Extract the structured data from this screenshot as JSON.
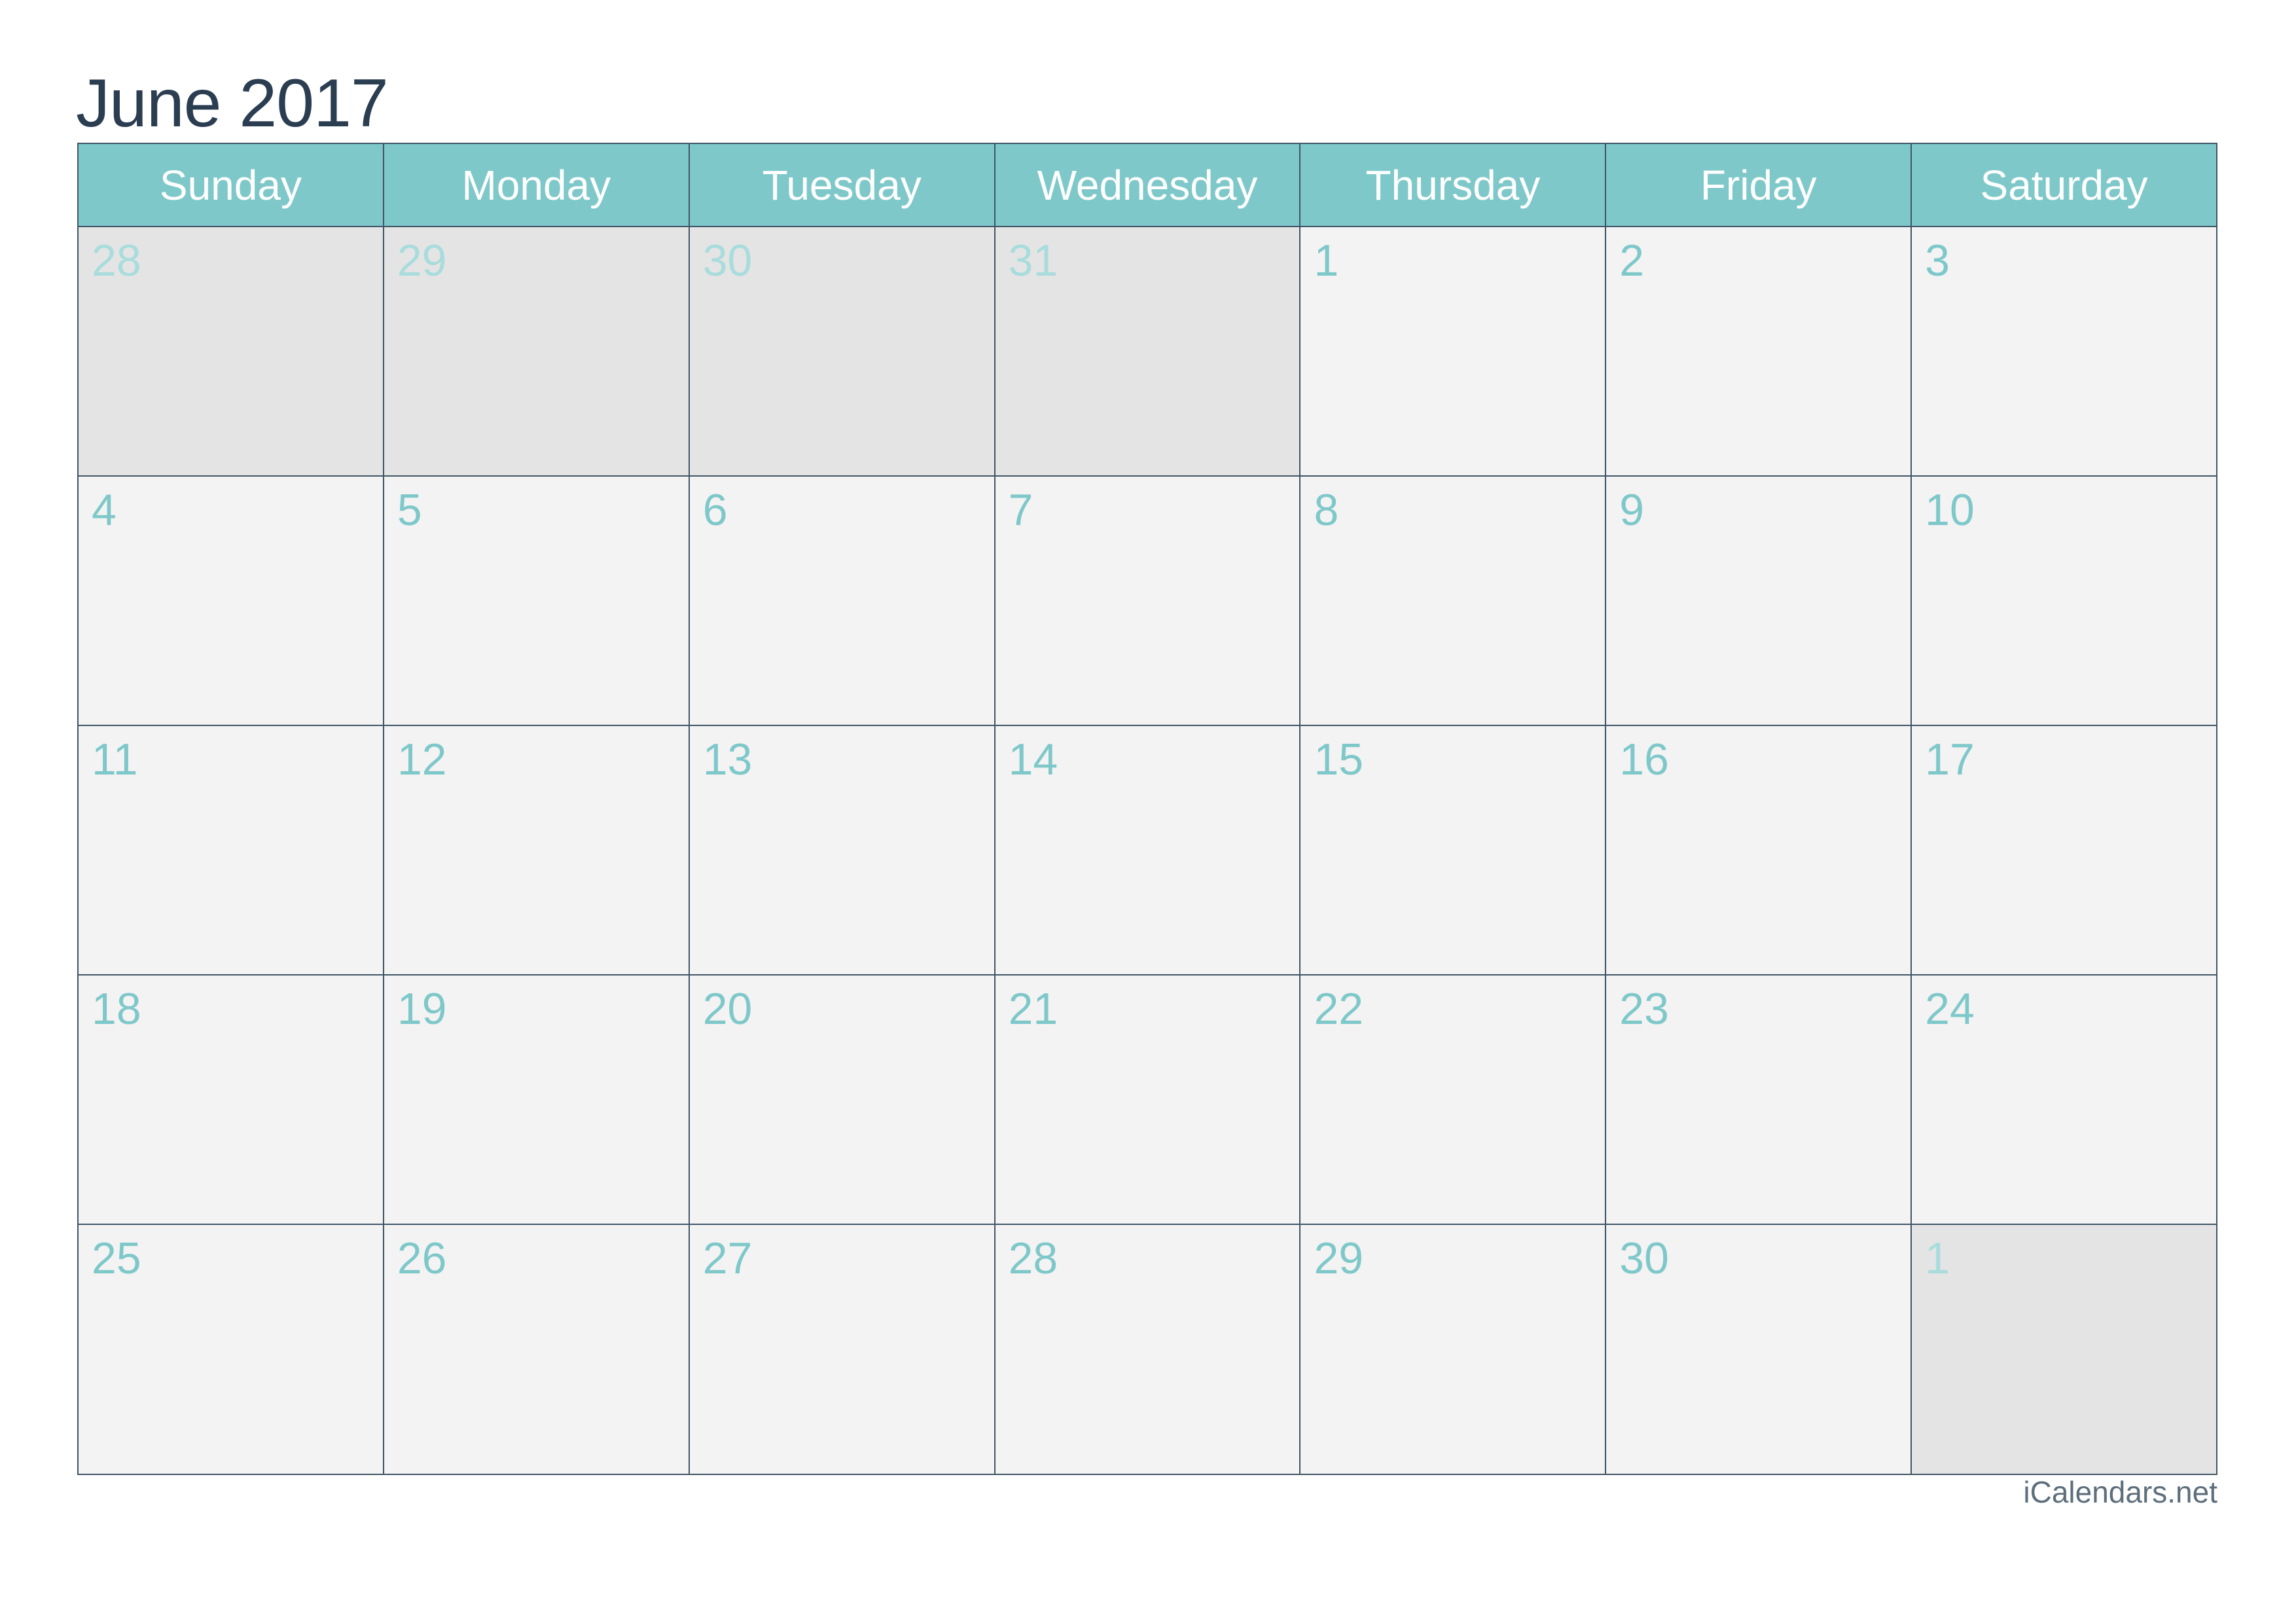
{
  "title": "June 2017",
  "colors": {
    "header_bg": "#7fc8ca",
    "title_text": "#2b3d51",
    "day_number": "#7fc8ca",
    "other_month_number": "#a9dcdc",
    "cell_bg": "#f3f3f3",
    "other_month_bg": "#e4e4e4",
    "grid_line": "#3f5566"
  },
  "weekdays": [
    "Sunday",
    "Monday",
    "Tuesday",
    "Wednesday",
    "Thursday",
    "Friday",
    "Saturday"
  ],
  "weeks": [
    [
      {
        "day": "28",
        "other": true
      },
      {
        "day": "29",
        "other": true
      },
      {
        "day": "30",
        "other": true
      },
      {
        "day": "31",
        "other": true
      },
      {
        "day": "1",
        "other": false
      },
      {
        "day": "2",
        "other": false
      },
      {
        "day": "3",
        "other": false
      }
    ],
    [
      {
        "day": "4",
        "other": false
      },
      {
        "day": "5",
        "other": false
      },
      {
        "day": "6",
        "other": false
      },
      {
        "day": "7",
        "other": false
      },
      {
        "day": "8",
        "other": false
      },
      {
        "day": "9",
        "other": false
      },
      {
        "day": "10",
        "other": false
      }
    ],
    [
      {
        "day": "11",
        "other": false
      },
      {
        "day": "12",
        "other": false
      },
      {
        "day": "13",
        "other": false
      },
      {
        "day": "14",
        "other": false
      },
      {
        "day": "15",
        "other": false
      },
      {
        "day": "16",
        "other": false
      },
      {
        "day": "17",
        "other": false
      }
    ],
    [
      {
        "day": "18",
        "other": false
      },
      {
        "day": "19",
        "other": false
      },
      {
        "day": "20",
        "other": false
      },
      {
        "day": "21",
        "other": false
      },
      {
        "day": "22",
        "other": false
      },
      {
        "day": "23",
        "other": false
      },
      {
        "day": "24",
        "other": false
      }
    ],
    [
      {
        "day": "25",
        "other": false
      },
      {
        "day": "26",
        "other": false
      },
      {
        "day": "27",
        "other": false
      },
      {
        "day": "28",
        "other": false
      },
      {
        "day": "29",
        "other": false
      },
      {
        "day": "30",
        "other": false
      },
      {
        "day": "1",
        "other": true
      }
    ]
  ],
  "footer": "iCalendars.net"
}
